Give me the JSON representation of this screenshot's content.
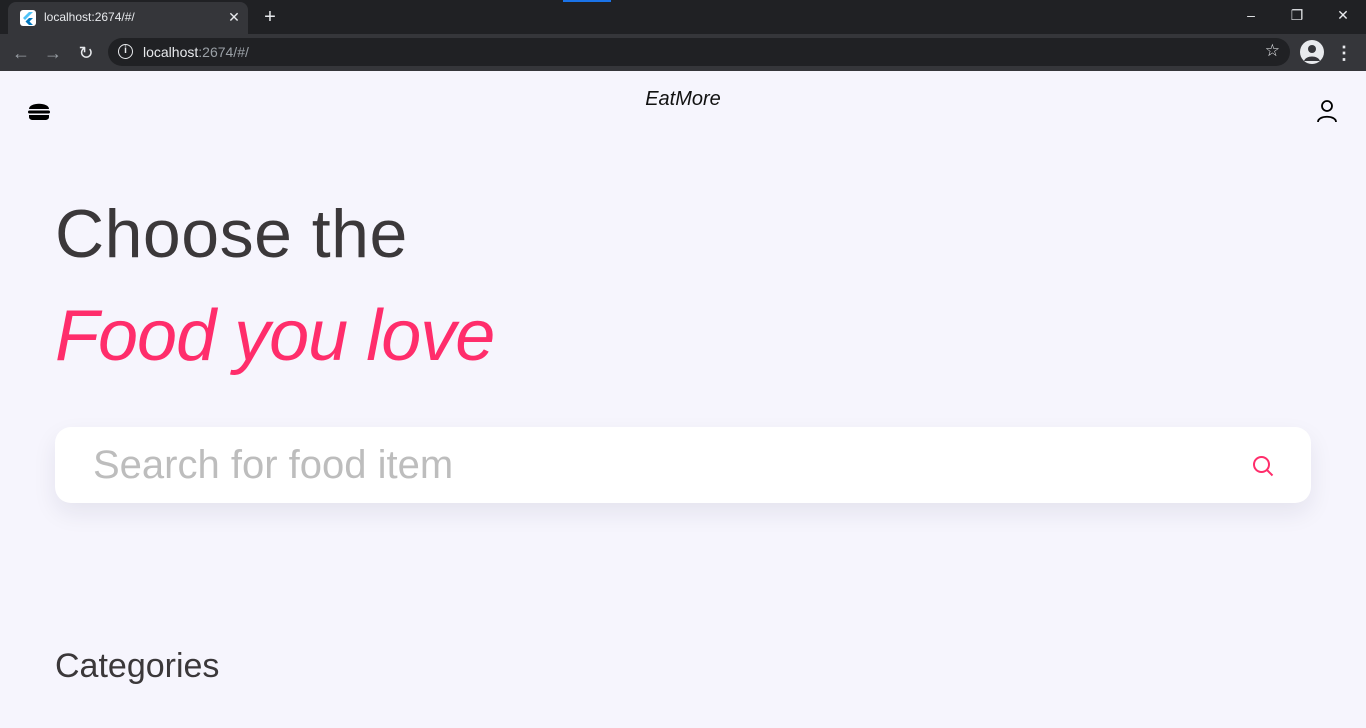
{
  "browser": {
    "tab_title": "localhost:2674/#/",
    "tab_close": "✕",
    "new_tab": "+",
    "url_host": "localhost",
    "url_rest": ":2674/#/",
    "window_controls": {
      "minimize": "–",
      "restore": "❐",
      "close": "✕"
    }
  },
  "app": {
    "brand": "EatMore",
    "hero": {
      "line1": "Choose the",
      "line2": "Food you love"
    },
    "search": {
      "placeholder": "Search for food item"
    },
    "categories_title": "Categories",
    "colors": {
      "accent": "#ff2d6b",
      "background": "#f6f5fd",
      "text": "#3b383a"
    },
    "icons": {
      "menu": "burger-icon",
      "account": "user-icon",
      "search": "search-icon"
    }
  }
}
